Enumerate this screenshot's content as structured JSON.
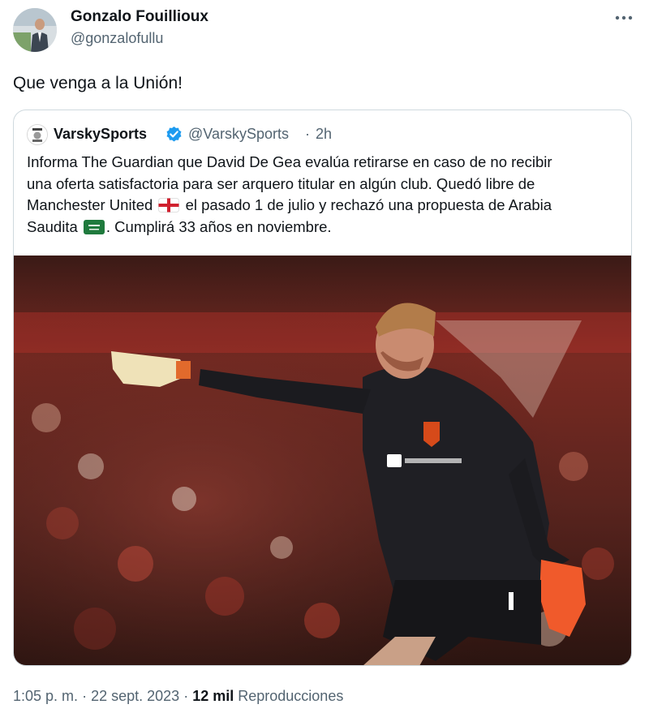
{
  "author": {
    "name": "Gonzalo Fouillioux",
    "handle": "@gonzalofullu"
  },
  "tweet": {
    "text": "Que venga a la Unión!"
  },
  "quoted": {
    "name": "VarskySports",
    "handle": "@VarskySports",
    "separator": "·",
    "time": "2h",
    "lines": [
      "Informa The Guardian que David De Gea evalúa retirarse en caso de no recibir",
      "una oferta satisfactoria para ser arquero titular en algún club. Quedó libre de",
      "Manchester United",
      "el pasado 1 de julio y rechazó una propuesta de Arabia",
      "Saudita",
      ". Cumplirá 33 años en noviembre."
    ],
    "flags": [
      "england-flag-icon",
      "saudi-flag-icon"
    ]
  },
  "footer": {
    "time": "1:05 p. m.",
    "sep1": "·",
    "date": "22 sept. 2023",
    "sep2": "·",
    "views_count": "12 mil",
    "views_label": "Reproducciones"
  },
  "colors": {
    "verified": "#1d9bf0",
    "secondary_text": "#536471",
    "border": "#cfd9de"
  }
}
